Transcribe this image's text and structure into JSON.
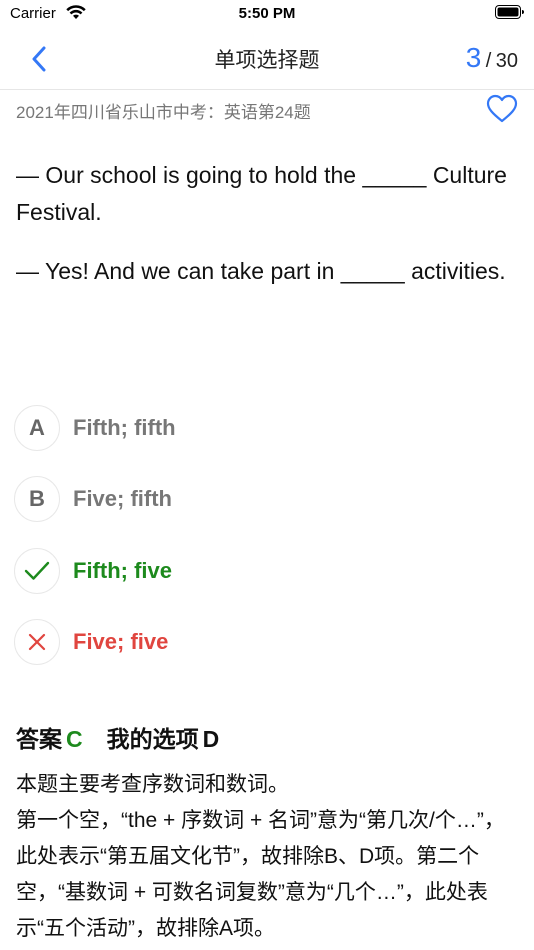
{
  "status_bar": {
    "carrier": "Carrier",
    "time": "5:50 PM"
  },
  "nav": {
    "title": "单项选择题",
    "current": "3",
    "separator": "/",
    "total": "30",
    "accent_color": "#3478f6"
  },
  "source": "2021年四川省乐山市中考：英语第24题",
  "question": {
    "line1": "— Our school is going to hold the _____ Culture Festival.",
    "line2": "— Yes! And we can take part in _____ activities."
  },
  "options": [
    {
      "key": "A",
      "text": "Fifth; fifth",
      "state": "normal"
    },
    {
      "key": "B",
      "text": "Five; fifth",
      "state": "normal"
    },
    {
      "key": "C",
      "text": "Fifth; five",
      "state": "correct",
      "icon": "checkmark-icon"
    },
    {
      "key": "D",
      "text": "Five; five",
      "state": "wrong",
      "icon": "cross-icon"
    }
  ],
  "answer": {
    "label": "答案",
    "letter": "C",
    "my_choice_label": "我的选项",
    "my_choice_letter": "D"
  },
  "explanation": {
    "p1": "本题主要考查序数词和数词。",
    "p2": "第一个空，“the + 序数词 + 名词”意为“第几次/个…”，此处表示“第五届文化节”，故排除B、D项。第二个空，“基数词 + 可数名词复数”意为“几个…”，此处表示“五个活动”，故排除A项。"
  },
  "colors": {
    "correct": "#1d8a1d",
    "wrong": "#e0453f"
  }
}
